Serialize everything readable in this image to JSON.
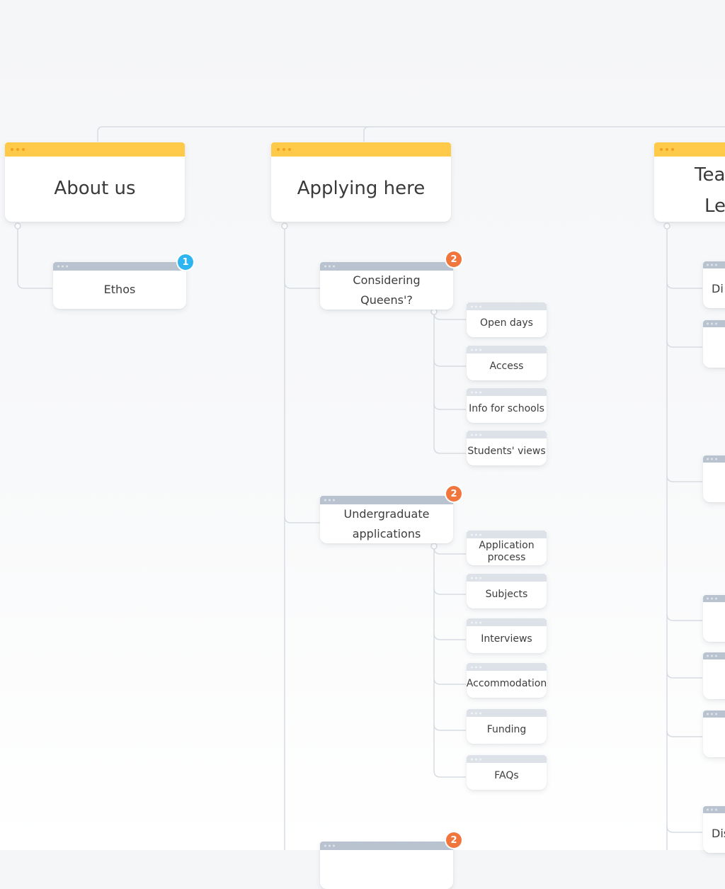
{
  "sections": {
    "about": {
      "title": "About us",
      "children": [
        {
          "label": "Ethos",
          "badge": "1"
        }
      ]
    },
    "applying": {
      "title": "Applying here",
      "considering": {
        "label": "Considering Queens'?",
        "badge": "2",
        "children": [
          "Open days",
          "Access",
          "Info for schools",
          "Students' views"
        ]
      },
      "undergrad": {
        "label": "Undergraduate applications",
        "badge": "2",
        "children": [
          "Application process",
          "Subjects",
          "Interviews",
          "Accommodation",
          "Funding",
          "FAQs"
        ]
      },
      "third": {
        "badge": "2"
      }
    },
    "teaching": {
      "title_line1": "Tea",
      "title_line2": "Le",
      "children": [
        "Di",
        "",
        "",
        "",
        "",
        "",
        "Dis"
      ]
    }
  },
  "colors": {
    "top_bar": "#ffc94a",
    "mid_bar": "#b9c3cf",
    "leaf_bar": "#dde2e8",
    "badge_blue": "#2cb5f0",
    "badge_orange": "#f0763e",
    "connector": "#d7dce2"
  }
}
